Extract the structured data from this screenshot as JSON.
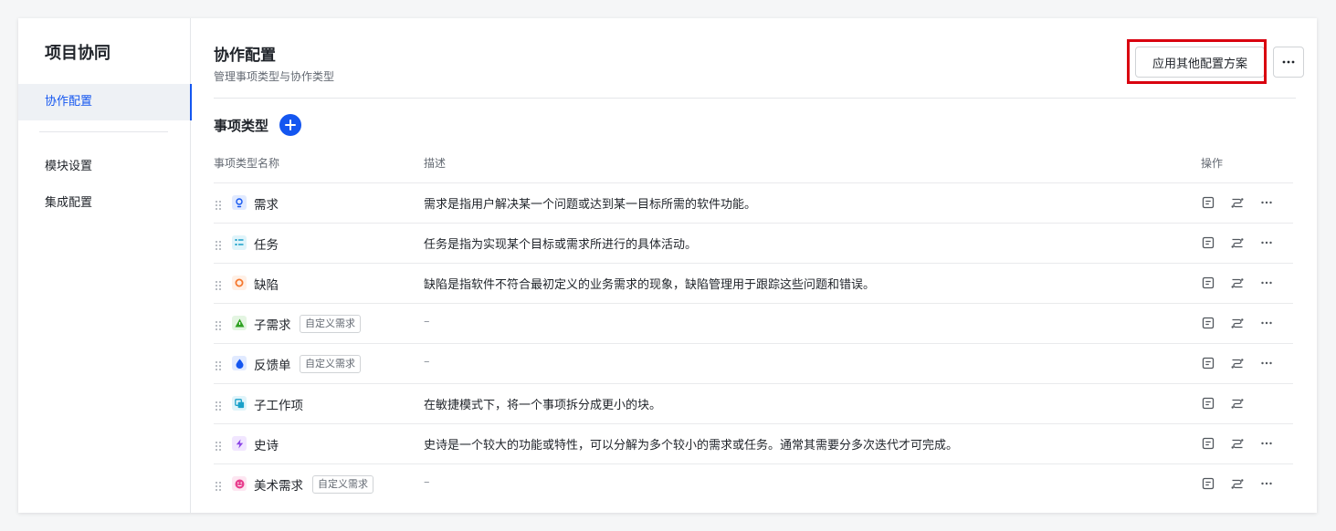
{
  "sidebar": {
    "app_title": "项目协同",
    "items": [
      {
        "label": "协作配置",
        "active": true
      },
      {
        "label": "模块设置",
        "active": false
      },
      {
        "label": "集成配置",
        "active": false
      }
    ]
  },
  "header": {
    "title": "协作配置",
    "subtitle": "管理事项类型与协作类型",
    "apply_button": "应用其他配置方案",
    "more_icon": "more-horizontal-icon"
  },
  "section": {
    "title": "事项类型",
    "add_icon": "plus-icon"
  },
  "table": {
    "columns": [
      "事项类型名称",
      "描述",
      "操作"
    ],
    "rows": [
      {
        "name": "需求",
        "icon": "lightbulb-icon",
        "icon_color": "#1456f0",
        "icon_bg": "#e1eaff",
        "tag": "",
        "description": "需求是指用户解决某一个问题或达到某一目标所需的软件功能。",
        "has_more": true
      },
      {
        "name": "任务",
        "icon": "checklist-icon",
        "icon_color": "#1aa0c9",
        "icon_bg": "#e0f4fa",
        "tag": "",
        "description": "任务是指为实现某个目标或需求所进行的具体活动。",
        "has_more": true
      },
      {
        "name": "缺陷",
        "icon": "circle-icon",
        "icon_color": "#f5772d",
        "icon_bg": "#fff0e6",
        "tag": "",
        "description": "缺陷是指软件不符合最初定义的业务需求的现象，缺陷管理用于跟踪这些问题和错误。",
        "has_more": true
      },
      {
        "name": "子需求",
        "icon": "triangle-icon",
        "icon_color": "#2ea121",
        "icon_bg": "#e4f5e2",
        "tag": "自定义需求",
        "description": "–",
        "has_more": true
      },
      {
        "name": "反馈单",
        "icon": "drop-icon",
        "icon_color": "#1456f0",
        "icon_bg": "#e1eaff",
        "tag": "自定义需求",
        "description": "–",
        "has_more": true
      },
      {
        "name": "子工作项",
        "icon": "copy-icon",
        "icon_color": "#1aa0c9",
        "icon_bg": "#e0f4fa",
        "tag": "",
        "description": "在敏捷模式下，将一个事项拆分成更小的块。",
        "has_more": false
      },
      {
        "name": "史诗",
        "icon": "lightning-icon",
        "icon_color": "#8a43e6",
        "icon_bg": "#f1e6ff",
        "tag": "",
        "description": "史诗是一个较大的功能或特性，可以分解为多个较小的需求或任务。通常其需要分多次迭代才可完成。",
        "has_more": true
      },
      {
        "name": "美术需求",
        "icon": "smile-icon",
        "icon_color": "#e83f8e",
        "icon_bg": "#fde6f1",
        "tag": "自定义需求",
        "description": "–",
        "has_more": true
      }
    ],
    "action_icons": [
      "form-icon",
      "workflow-icon",
      "more-horizontal-icon"
    ]
  },
  "colors": {
    "accent": "#1456f0",
    "highlight": "#d9000f"
  }
}
